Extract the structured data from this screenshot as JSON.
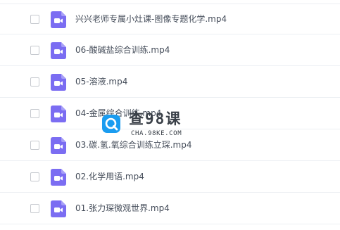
{
  "files": [
    {
      "name": "兴兴老师专属小灶课-图像专题化学.mp4",
      "icon": "video-file-icon"
    },
    {
      "name": "06-酸碱盐综合训练.mp4",
      "icon": "video-file-icon"
    },
    {
      "name": "05-溶液.mp4",
      "icon": "video-file-icon"
    },
    {
      "name": "04-金属综合训练.mp4",
      "icon": "video-file-icon"
    },
    {
      "name": "03.碳.氢.氧综合训练立琛.mp4",
      "icon": "video-file-icon"
    },
    {
      "name": "02.化学用语.mp4",
      "icon": "video-file-icon"
    },
    {
      "name": "01.张力琛微观世界.mp4",
      "icon": "video-file-icon"
    }
  ],
  "watermark": {
    "title": "查98课",
    "subtitle": "CHA.98KE.COM",
    "icon": "watermark-logo-icon"
  },
  "colors": {
    "icon_purple": "#7b6df2",
    "text": "#454d5a",
    "divider": "#eceff3",
    "checkbox_border": "#c6c9cf",
    "watermark_blue": "#1a9cf0"
  }
}
